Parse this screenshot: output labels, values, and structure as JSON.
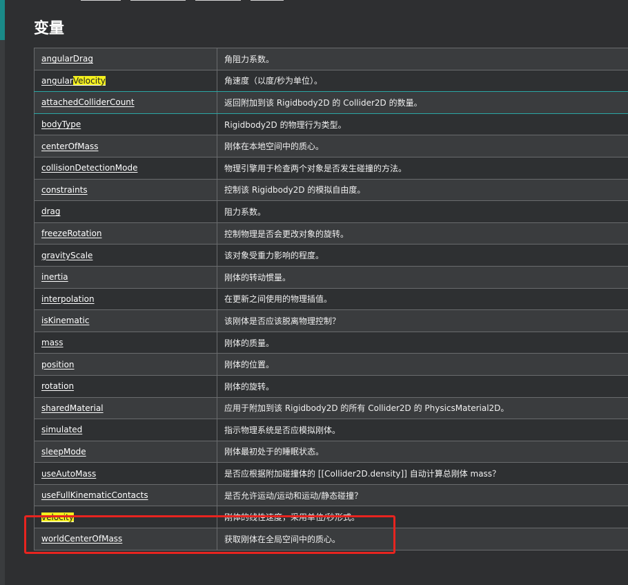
{
  "title": "变量",
  "rows": [
    {
      "prop": "angularDrag",
      "desc": "角阻力系数。"
    },
    {
      "prop_pre": "angular",
      "prop_hl": "Velocity",
      "desc": "角速度（以度/秒为单位）。"
    },
    {
      "prop": "attachedColliderCount",
      "desc": "返回附加到该 Rigidbody2D 的 Collider2D 的数量。"
    },
    {
      "prop": "bodyType",
      "desc": "Rigidbody2D 的物理行为类型。"
    },
    {
      "prop": "centerOfMass",
      "desc": "刚体在本地空间中的质心。"
    },
    {
      "prop": "collisionDetectionMode",
      "desc": "物理引擎用于检查两个对象是否发生碰撞的方法。"
    },
    {
      "prop": "constraints",
      "desc": "控制该 Rigidbody2D 的模拟自由度。"
    },
    {
      "prop": "drag",
      "desc": "阻力系数。"
    },
    {
      "prop": "freezeRotation",
      "desc": "控制物理是否会更改对象的旋转。"
    },
    {
      "prop": "gravityScale",
      "desc": "该对象受重力影响的程度。"
    },
    {
      "prop": "inertia",
      "desc": "刚体的转动惯量。"
    },
    {
      "prop": "interpolation",
      "desc": "在更新之间使用的物理插值。"
    },
    {
      "prop": "isKinematic",
      "desc": "该刚体是否应该脱离物理控制？"
    },
    {
      "prop": "mass",
      "desc": "刚体的质量。"
    },
    {
      "prop": "position",
      "desc": "刚体的位置。"
    },
    {
      "prop": "rotation",
      "desc": "刚体的旋转。"
    },
    {
      "prop": "sharedMaterial",
      "desc": "应用于附加到该 Rigidbody2D 的所有 Collider2D 的 PhysicsMaterial2D。"
    },
    {
      "prop": "simulated",
      "desc": "指示物理系统是否应模拟刚体。"
    },
    {
      "prop": "sleepMode",
      "desc": "刚体最初处于的睡眠状态。"
    },
    {
      "prop": "useAutoMass",
      "desc": "是否应根据附加碰撞体的 [[Collider2D.density]] 自动计算总刚体 mass？"
    },
    {
      "prop": "useFullKinematicContacts",
      "desc": "是否允许运动/运动和运动/静态碰撞？"
    },
    {
      "prop_hl": "velocity",
      "desc": "刚体的线性速度，采用单位/秒形式。"
    },
    {
      "prop": "worldCenterOfMass",
      "desc": "获取刚体在全局空间中的质心。"
    }
  ],
  "colors": {
    "background": "#2e2f31",
    "highlight": "#f3ef1d",
    "annotation": "#e8241f",
    "accent": "#1a8a88"
  }
}
